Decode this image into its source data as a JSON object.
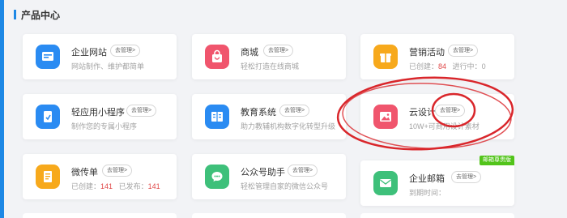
{
  "section": {
    "title": "产品中心"
  },
  "manage_label": "去管理>",
  "cards": {
    "website": {
      "title": "企业网站",
      "desc": "网站制作、维护都简单"
    },
    "mall": {
      "title": "商城",
      "desc": "轻松打造在线商城"
    },
    "marketing": {
      "title": "营销活动",
      "created_label": "已创建：",
      "created_count": "84",
      "running_label": "进行中：",
      "running_count": "0"
    },
    "miniapp": {
      "title": "轻应用小程序",
      "desc": "制作您的专属小程序"
    },
    "education": {
      "title": "教育系统",
      "desc": "助力教辅机构数字化转型升级"
    },
    "design": {
      "title": "云设计",
      "desc": "10W+可商用设计素材"
    },
    "flyer": {
      "title": "微传单",
      "created_label": "已创建：",
      "created_count": "141",
      "published_label": "已发布：",
      "published_count": "141"
    },
    "wechat": {
      "title": "公众号助手",
      "desc": "轻松管理自家的微信公众号"
    },
    "mail": {
      "title": "企业邮箱",
      "badge": "邮箱尊贵版",
      "desc": "到期时间："
    }
  },
  "colors": {
    "accent": "#1e88e5",
    "annotation": "#d9262b",
    "count_red": "#e04848",
    "badge_green": "#52c41a"
  }
}
